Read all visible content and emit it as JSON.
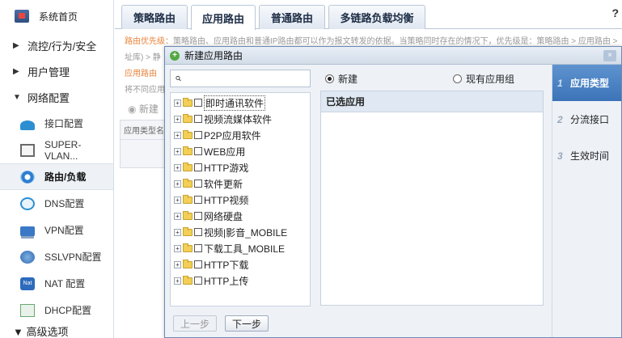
{
  "sidebar": {
    "home_label": "系统首页",
    "groups": [
      {
        "label": "流控/行为/安全",
        "expanded": false
      },
      {
        "label": "用户管理",
        "expanded": false
      },
      {
        "label": "网络配置",
        "expanded": true
      }
    ],
    "items": [
      {
        "label": "接口配置",
        "icon": "interface-icon"
      },
      {
        "label": "SUPER-VLAN...",
        "icon": "super-vlan-icon"
      },
      {
        "label": "路由/负载",
        "icon": "routing-icon",
        "active": true
      },
      {
        "label": "DNS配置",
        "icon": "dns-icon"
      },
      {
        "label": "VPN配置",
        "icon": "vpn-icon"
      },
      {
        "label": "SSLVPN配置",
        "icon": "sslvpn-icon"
      },
      {
        "label": "NAT 配置",
        "icon": "nat-icon"
      },
      {
        "label": "DHCP配置",
        "icon": "dhcp-icon"
      }
    ],
    "bottom_group": "高级选项"
  },
  "tabs": [
    {
      "label": "策略路由"
    },
    {
      "label": "应用路由",
      "active": true
    },
    {
      "label": "普通路由"
    },
    {
      "label": "多链路负载均衡"
    }
  ],
  "help_label": "?",
  "background_page": {
    "note_prefix": "路由优先级：",
    "note_text": "策略路由、应用路由和普通IP路由都可以作为报文转发的依据。当策略同时存在的情况下，优先级是：策略路由 > 应用路由 > 静态路",
    "line2": "址库) > 静",
    "line3_prefix": "应用路由",
    "line4": "将不同应用",
    "new_label": "新建",
    "col_label": "应用类型名"
  },
  "dialog": {
    "title": "新建应用路由",
    "close_label": "×",
    "search_placeholder": "",
    "tree": [
      {
        "label": "即时通讯软件",
        "selected": true
      },
      {
        "label": "视频流媒体软件"
      },
      {
        "label": "P2P应用软件"
      },
      {
        "label": "WEB应用"
      },
      {
        "label": "HTTP游戏"
      },
      {
        "label": "软件更新"
      },
      {
        "label": "HTTP视频"
      },
      {
        "label": "网络硬盘"
      },
      {
        "label": "视频|影音_MOBILE"
      },
      {
        "label": "下载工具_MOBILE"
      },
      {
        "label": "HTTP下载"
      },
      {
        "label": "HTTP上传"
      }
    ],
    "radio_new": "新建",
    "radio_existing": "现有应用组",
    "selected_header": "已选应用",
    "steps": [
      {
        "num": "1",
        "label": "应用类型",
        "active": true
      },
      {
        "num": "2",
        "label": "分流接口"
      },
      {
        "num": "3",
        "label": "生效时间"
      }
    ],
    "prev_button": "上一步",
    "next_button": "下一步"
  }
}
